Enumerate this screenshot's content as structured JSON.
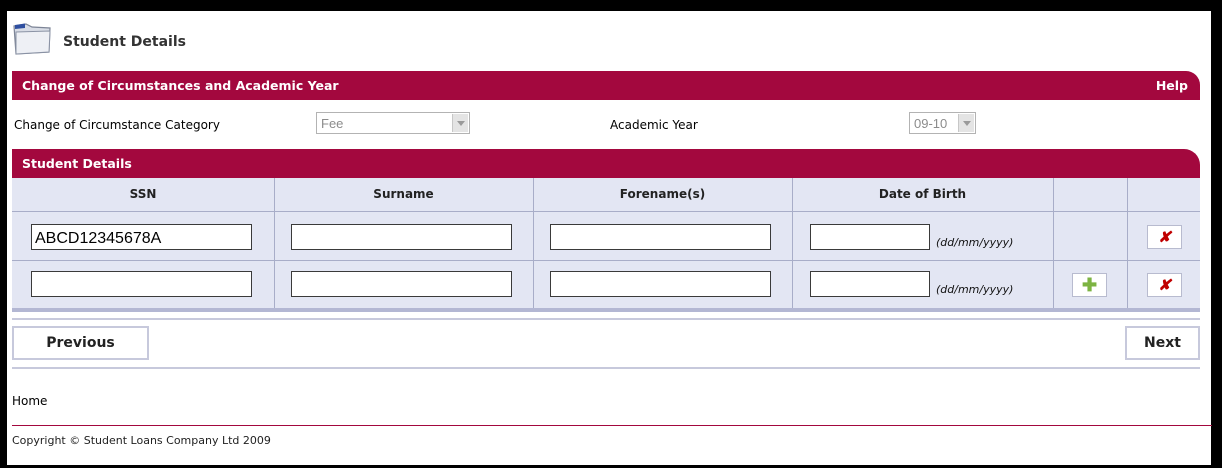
{
  "header": {
    "title": "Student Details",
    "icon": "folder-icon"
  },
  "section1": {
    "title": "Change of Circumstances and Academic Year",
    "help": "Help"
  },
  "form": {
    "coc_category_label": "Change of Circumstance Category",
    "coc_category_value": "Fee",
    "academic_year_label": "Academic Year",
    "academic_year_value": "09-10"
  },
  "section2": {
    "title": "Student Details"
  },
  "table": {
    "headers": [
      "SSN",
      "Surname",
      "Forename(s)",
      "Date of Birth"
    ],
    "date_hint": "(dd/mm/yyyy)",
    "rows": [
      {
        "ssn": "ABCD12345678A",
        "surname": "",
        "forename": "",
        "dob": ""
      },
      {
        "ssn": "",
        "surname": "",
        "forename": "",
        "dob": ""
      }
    ],
    "add_icon": "plus-icon",
    "remove_icon": "x-icon",
    "add_glyph": "✚",
    "remove_glyph": "✘"
  },
  "nav": {
    "previous": "Previous",
    "next": "Next"
  },
  "footer": {
    "home": "Home",
    "copyright": "Copyright © Student Loans Company Ltd 2009"
  },
  "colors": {
    "brand": "#a3083e",
    "grid_bg": "#e3e6f3",
    "grid_lines": "#a8adc8"
  }
}
